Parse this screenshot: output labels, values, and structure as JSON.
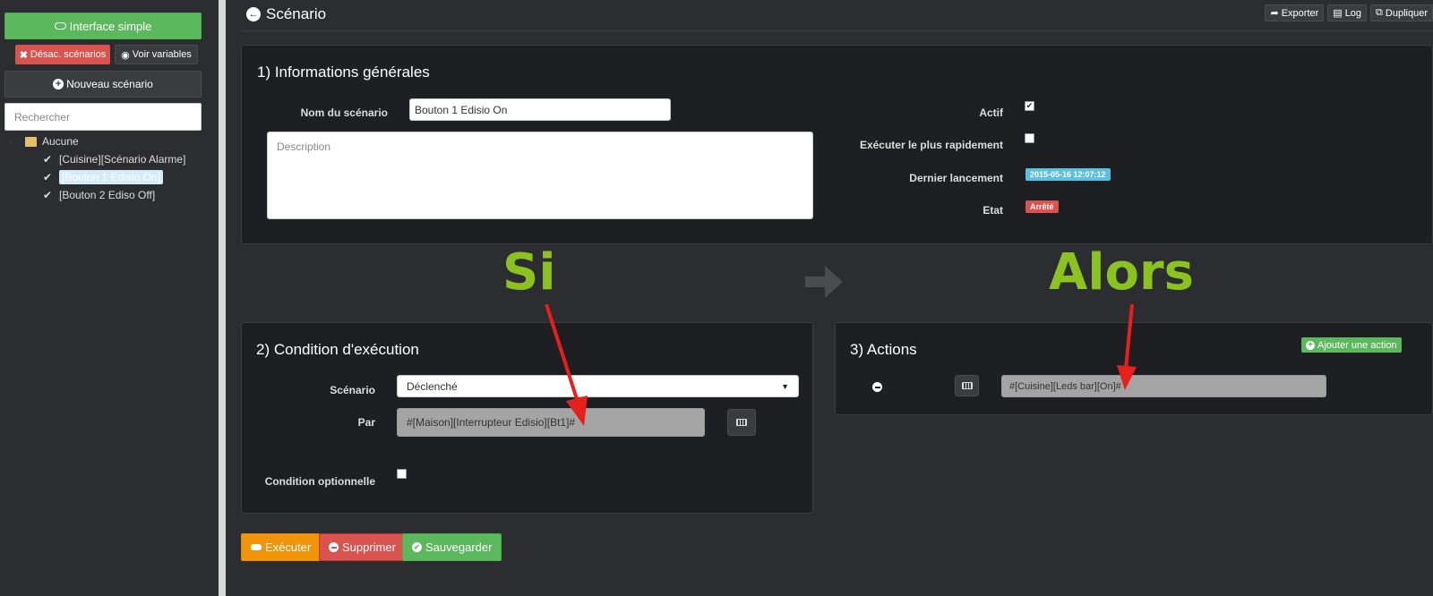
{
  "sidebar": {
    "simple_interface": "Interface simple",
    "desac_scenarios": "Désac. scénarios",
    "show_variables": "Voir variables",
    "new_scenario": "Nouveau scénario",
    "search_placeholder": "Rechercher",
    "group": "Aucune",
    "items": [
      {
        "label": "[Cuisine][Scénario Alarme]",
        "active": false
      },
      {
        "label": "[Bouton 1 Edisio On]",
        "active": true
      },
      {
        "label": "[Bouton 2 Ediso Off]",
        "active": false
      }
    ]
  },
  "header": {
    "title": "Scénario",
    "export": "Exporter",
    "log": "Log",
    "duplicate": "Dupliquer"
  },
  "general": {
    "title": "1) Informations générales",
    "name_label": "Nom du scénario",
    "name_value": "Bouton 1 Edisio On",
    "description_placeholder": "Description",
    "active_label": "Actif",
    "active_checked": true,
    "fast_label": "Exécuter le plus rapidement",
    "fast_checked": false,
    "last_run_label": "Dernier lancement",
    "last_run_value": "2015-05-16 12:07:12",
    "state_label": "Etat",
    "state_value": "Arrêté"
  },
  "annotations": {
    "si": "Si",
    "alors": "Alors"
  },
  "condition": {
    "title": "2) Condition d'exécution",
    "scenario_label": "Scénario",
    "scenario_value": "Déclenché",
    "by_label": "Par",
    "by_value": "#[Maison][Interrupteur Edisio][Bt1]#",
    "optional_label": "Condition optionnelle"
  },
  "actions": {
    "title": "3) Actions",
    "add_label": "Ajouter une action",
    "action_value": "#[Cuisine][Leds bar][On]#"
  },
  "footer": {
    "execute": "Exécuter",
    "delete": "Supprimer",
    "save": "Sauvegarder"
  },
  "colors": {
    "accent_green": "#5cb85c",
    "danger_red": "#d9534f",
    "warning_orange": "#f0940a",
    "info_blue": "#5bc0de",
    "annotation_green": "#8bc220",
    "annotation_red": "#e8201b"
  }
}
